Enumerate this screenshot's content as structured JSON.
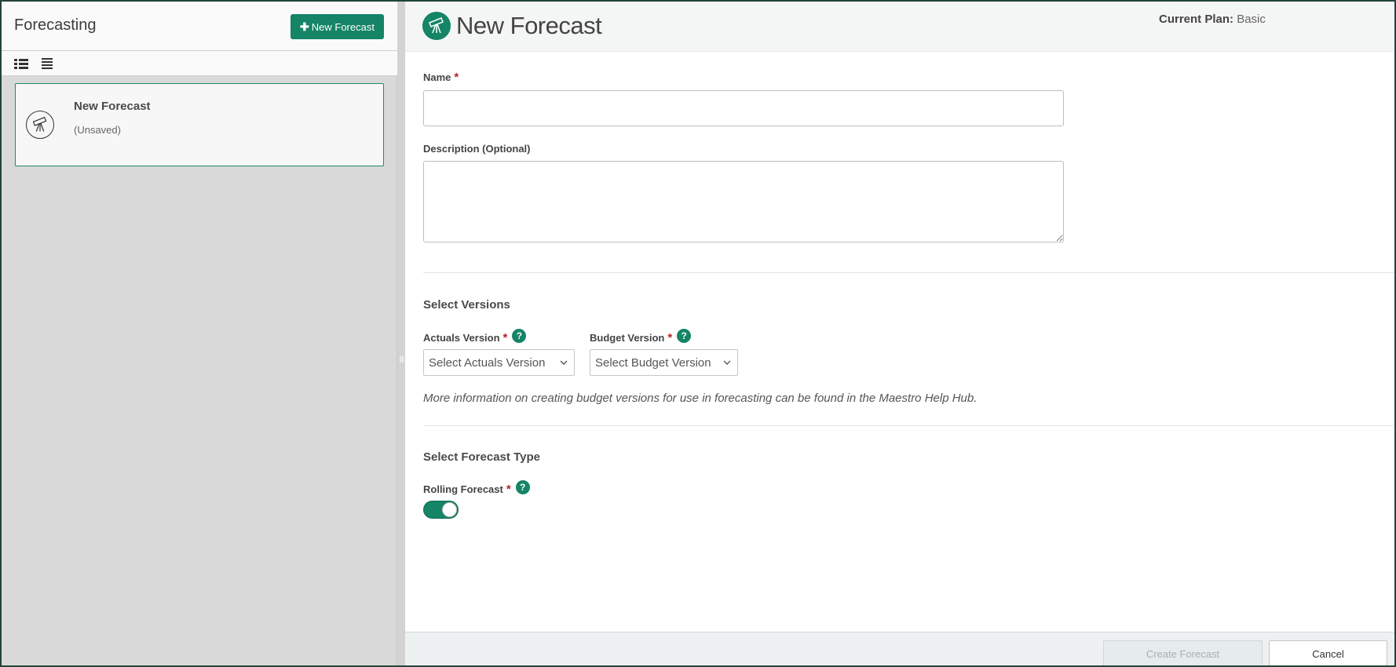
{
  "left_panel": {
    "title": "Forecasting",
    "new_button_label": "New Forecast",
    "toolbar": {
      "icons": [
        "list-detail-icon",
        "list-compact-icon"
      ]
    },
    "cards": [
      {
        "title": "New Forecast",
        "subtitle": "(Unsaved)",
        "icon": "telescope-icon"
      }
    ]
  },
  "header": {
    "title": "New Forecast",
    "icon": "telescope-icon",
    "plan_label": "Current Plan:",
    "plan_value": "Basic"
  },
  "form": {
    "name_label": "Name",
    "name_value": "",
    "required_marker": "*",
    "description_label": "Description (Optional)",
    "description_value": "",
    "versions_section": "Select Versions",
    "actuals_label": "Actuals Version",
    "actuals_placeholder": "Select Actuals Version",
    "budget_label": "Budget Version",
    "budget_placeholder": "Select Budget Version",
    "help_glyph": "?",
    "info_text": "More information on creating budget versions for use in forecasting can be found in the Maestro Help Hub.",
    "type_section": "Select Forecast Type",
    "rolling_label": "Rolling Forecast",
    "rolling_on": true
  },
  "footer": {
    "create_label": "Create Forecast",
    "cancel_label": "Cancel"
  },
  "colors": {
    "accent": "#158467",
    "required": "#b3232a"
  }
}
